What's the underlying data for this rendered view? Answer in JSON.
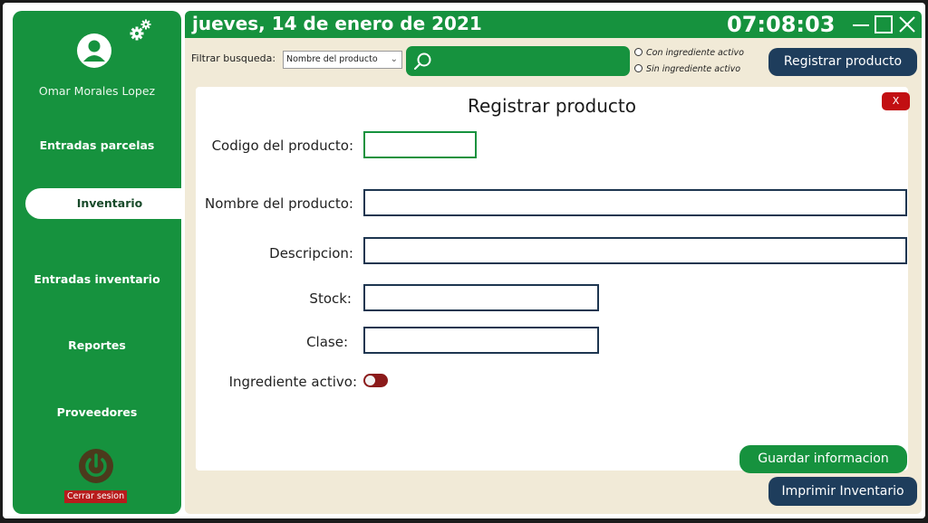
{
  "user": {
    "name": "Omar Morales Lopez"
  },
  "sidebar": {
    "items": [
      {
        "label": "Entradas parcelas"
      },
      {
        "label": "Inventario"
      },
      {
        "label": "Entradas inventario"
      },
      {
        "label": "Reportes"
      },
      {
        "label": "Proveedores"
      }
    ],
    "active_index": 1,
    "logout_label": "Cerrar sesion"
  },
  "header": {
    "date": "jueves, 14 de enero de 2021",
    "time": "07:08:03"
  },
  "toolbar": {
    "filter_label": "Filtrar busqueda:",
    "filter_selected": "Nombre del producto",
    "search_value": "",
    "radio_with": "Con ingrediente activo",
    "radio_without": "Sin ingrediente activo",
    "register_button": "Registrar producto"
  },
  "form": {
    "title": "Registrar producto",
    "close_label": "X",
    "code_label": "Codigo del producto:",
    "name_label": "Nombre del producto:",
    "description_label": "Descripcion:",
    "stock_label": "Stock:",
    "class_label": "Clase:",
    "active_ingredient_label": "Ingrediente activo:",
    "active_ingredient_on": false,
    "save_button": "Guardar informacion"
  },
  "footer": {
    "print_button": "Imprimir Inventario"
  },
  "colors": {
    "primary_green": "#16923e",
    "navy": "#1e3d5c",
    "danger_red": "#c20f12",
    "panel_bg": "#f1ead7"
  },
  "icons": [
    "gear-icon",
    "user-avatar-icon",
    "power-icon",
    "search-icon",
    "minimize-icon",
    "maximize-icon",
    "close-icon",
    "chevron-down-icon"
  ]
}
